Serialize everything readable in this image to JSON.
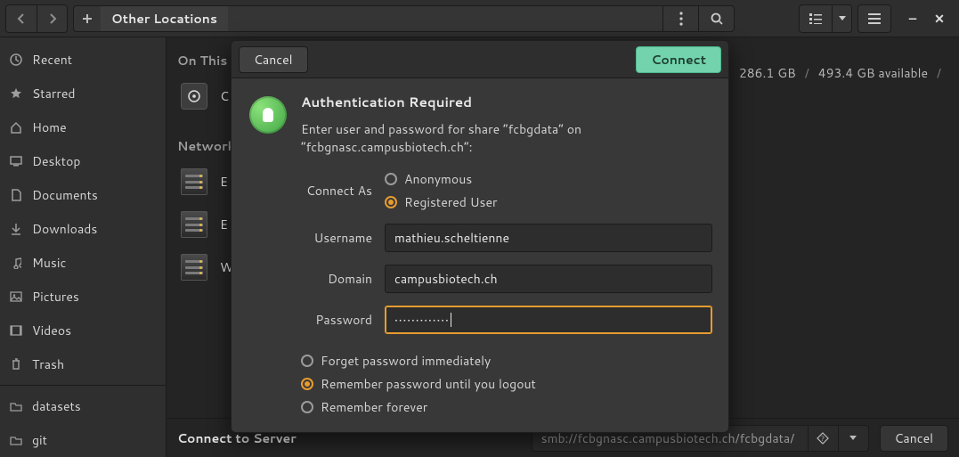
{
  "toolbar": {
    "location_label": "Other Locations"
  },
  "sidebar": {
    "items": [
      {
        "label": "Recent"
      },
      {
        "label": "Starred"
      },
      {
        "label": "Home"
      },
      {
        "label": "Desktop"
      },
      {
        "label": "Documents"
      },
      {
        "label": "Downloads"
      },
      {
        "label": "Music"
      },
      {
        "label": "Pictures"
      },
      {
        "label": "Videos"
      },
      {
        "label": "Trash"
      }
    ],
    "bookmarks": [
      {
        "label": "datasets"
      },
      {
        "label": "git"
      }
    ]
  },
  "content": {
    "section_computer": "On This Computer",
    "section_networks": "Networks",
    "computer_rows": [
      {
        "label": "Computer"
      }
    ],
    "network_rows": [
      {
        "label": "EEG"
      },
      {
        "label": "EEG"
      },
      {
        "label": "Windows Network"
      }
    ],
    "disk": {
      "used": "286.1 GB",
      "sep1": "/",
      "total": "493.4 GB available",
      "sep2": "/"
    }
  },
  "connectbar": {
    "label": "Connect to Server",
    "address": "smb://fcbgnasc.campusbiotech.ch/fcbgdata/",
    "cancel": "Cancel"
  },
  "dialog": {
    "cancel": "Cancel",
    "connect": "Connect",
    "title": "Authentication Required",
    "subtitle": "Enter user and password for share “fcbgdata” on “fcbgnasc.campusbiotech.ch”:",
    "connect_as_label": "Connect As",
    "connect_as": {
      "anonymous": "Anonymous",
      "registered": "Registered User"
    },
    "fields": {
      "username_label": "Username",
      "username_value": "mathieu.scheltienne",
      "domain_label": "Domain",
      "domain_value": "campusbiotech.ch",
      "password_label": "Password",
      "password_value": "•••••••••••••"
    },
    "pw_opts": {
      "forget": "Forget password immediately",
      "session": "Remember password until you logout",
      "forever": "Remember forever"
    }
  }
}
